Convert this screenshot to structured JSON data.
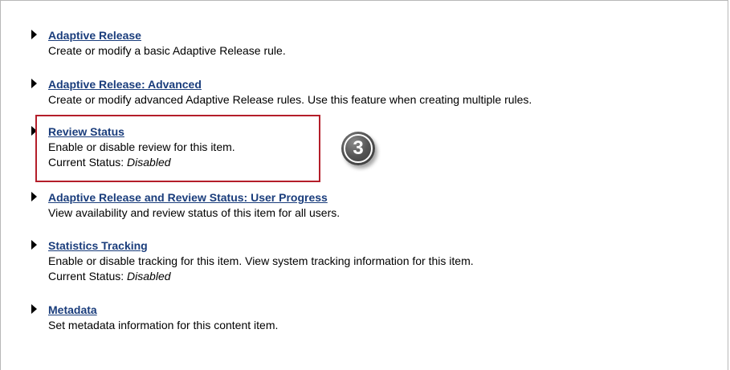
{
  "items": [
    {
      "label": "Adaptive Release",
      "description": "Create or modify a basic Adaptive Release rule."
    },
    {
      "label": "Adaptive Release: Advanced",
      "description": "Create or modify advanced Adaptive Release rules. Use this feature when creating multiple rules."
    },
    {
      "label": "Review Status",
      "description": "Enable or disable review for this item.",
      "status_label": "Current Status:",
      "status_value": "Disabled"
    },
    {
      "label": "Adaptive Release and Review Status: User Progress",
      "description": "View availability and review status of this item for all users."
    },
    {
      "label": "Statistics Tracking",
      "description": "Enable or disable tracking for this item. View system tracking information for this item.",
      "status_label": "Current Status:",
      "status_value": "Disabled"
    },
    {
      "label": "Metadata",
      "description": "Set metadata information for this content item."
    }
  ],
  "callout": {
    "step_number": "3",
    "highlight_color": "#b41e2a"
  },
  "colors": {
    "link": "#1a3d7c",
    "text": "#000000",
    "badge": "#555555"
  },
  "icons": {
    "bullet": "triangle-right-icon"
  }
}
